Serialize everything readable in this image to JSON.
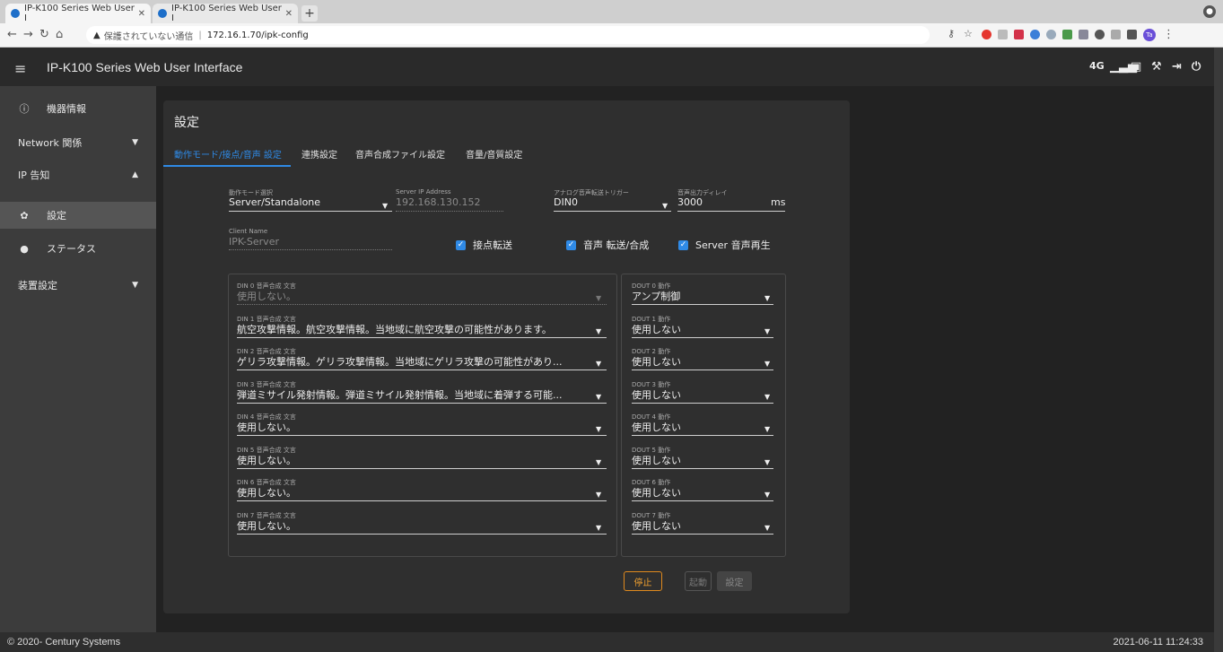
{
  "browser": {
    "tabs": [
      {
        "label": "IP-K100 Series Web User I",
        "active": true
      },
      {
        "label": "IP-K100 Series Web User I",
        "active": false
      }
    ],
    "new_tab": "+",
    "security_warning": "保護されていない通信",
    "url": "172.16.1.70/ipk-config",
    "profile": "Ta"
  },
  "app": {
    "title": "IP-K100 Series Web User Interface",
    "header_icons": [
      "4G",
      "signal-bars",
      "device",
      "tool",
      "logout",
      "power"
    ],
    "header_text_4g": "4G"
  },
  "sidebar": {
    "items": [
      {
        "label": "機器情報",
        "icon": "info-outline-icon"
      },
      {
        "label": "Network 関係",
        "chevron": "down"
      },
      {
        "label": "IP 告知",
        "chevron": "up"
      },
      {
        "label": "設定",
        "icon": "gear-icon",
        "selected": true
      },
      {
        "label": "ステータス",
        "icon": "info-filled-icon"
      },
      {
        "label": "装置設定",
        "chevron": "down"
      }
    ]
  },
  "card": {
    "title": "設定",
    "tabs": [
      "動作モード/接点/音声 設定",
      "連携設定",
      "音声合成ファイル設定",
      "音量/音質設定"
    ],
    "active_tab": 0
  },
  "form": {
    "mode_label": "動作モード選択",
    "mode_value": "Server/Standalone",
    "server_ip_label": "Server IP Address",
    "server_ip_value": "192.168.130.152",
    "trigger_label": "アナログ音声転送トリガー",
    "trigger_value": "DIN0",
    "delay_label": "音声出力ディレイ",
    "delay_value": "3000",
    "delay_unit": "ms",
    "client_name_label": "Client Name",
    "client_name_value": "IPK-Server",
    "checkboxes": [
      {
        "label": "接点転送",
        "checked": true
      },
      {
        "label": "音声 転送/合成",
        "checked": true
      },
      {
        "label": "Server 音声再生",
        "checked": true
      }
    ]
  },
  "din": [
    {
      "label": "DIN 0 音声合成 文言",
      "value": "使用しない。",
      "disabled": true
    },
    {
      "label": "DIN 1 音声合成 文言",
      "value": "航空攻撃情報。航空攻撃情報。当地域に航空攻撃の可能性があります。",
      "disabled": false
    },
    {
      "label": "DIN 2 音声合成 文言",
      "value": "ゲリラ攻撃情報。ゲリラ攻撃情報。当地域にゲリラ攻撃の可能性があり...",
      "disabled": false
    },
    {
      "label": "DIN 3 音声合成 文言",
      "value": "弾道ミサイル発射情報。弾道ミサイル発射情報。当地域に着弾する可能...",
      "disabled": false
    },
    {
      "label": "DIN 4 音声合成 文言",
      "value": "使用しない。",
      "disabled": false
    },
    {
      "label": "DIN 5 音声合成 文言",
      "value": "使用しない。",
      "disabled": false
    },
    {
      "label": "DIN 6 音声合成 文言",
      "value": "使用しない。",
      "disabled": false
    },
    {
      "label": "DIN 7 音声合成 文言",
      "value": "使用しない。",
      "disabled": false
    }
  ],
  "dout": [
    {
      "label": "DOUT 0 動作",
      "value": "アンプ制御"
    },
    {
      "label": "DOUT 1 動作",
      "value": "使用しない"
    },
    {
      "label": "DOUT 2 動作",
      "value": "使用しない"
    },
    {
      "label": "DOUT 3 動作",
      "value": "使用しない"
    },
    {
      "label": "DOUT 4 動作",
      "value": "使用しない"
    },
    {
      "label": "DOUT 5 動作",
      "value": "使用しない"
    },
    {
      "label": "DOUT 6 動作",
      "value": "使用しない"
    },
    {
      "label": "DOUT 7 動作",
      "value": "使用しない"
    }
  ],
  "buttons": {
    "stop": "停止",
    "start": "起動",
    "set": "設定"
  },
  "footer": {
    "copyright": "© 2020- Century Systems",
    "datetime": "2021-06-11 11:24:33"
  },
  "colors": {
    "accent": "#2f8ae6",
    "stop": "#e08a1e",
    "card": "#2f2f2f",
    "sidebar": "#3c3c3c"
  }
}
